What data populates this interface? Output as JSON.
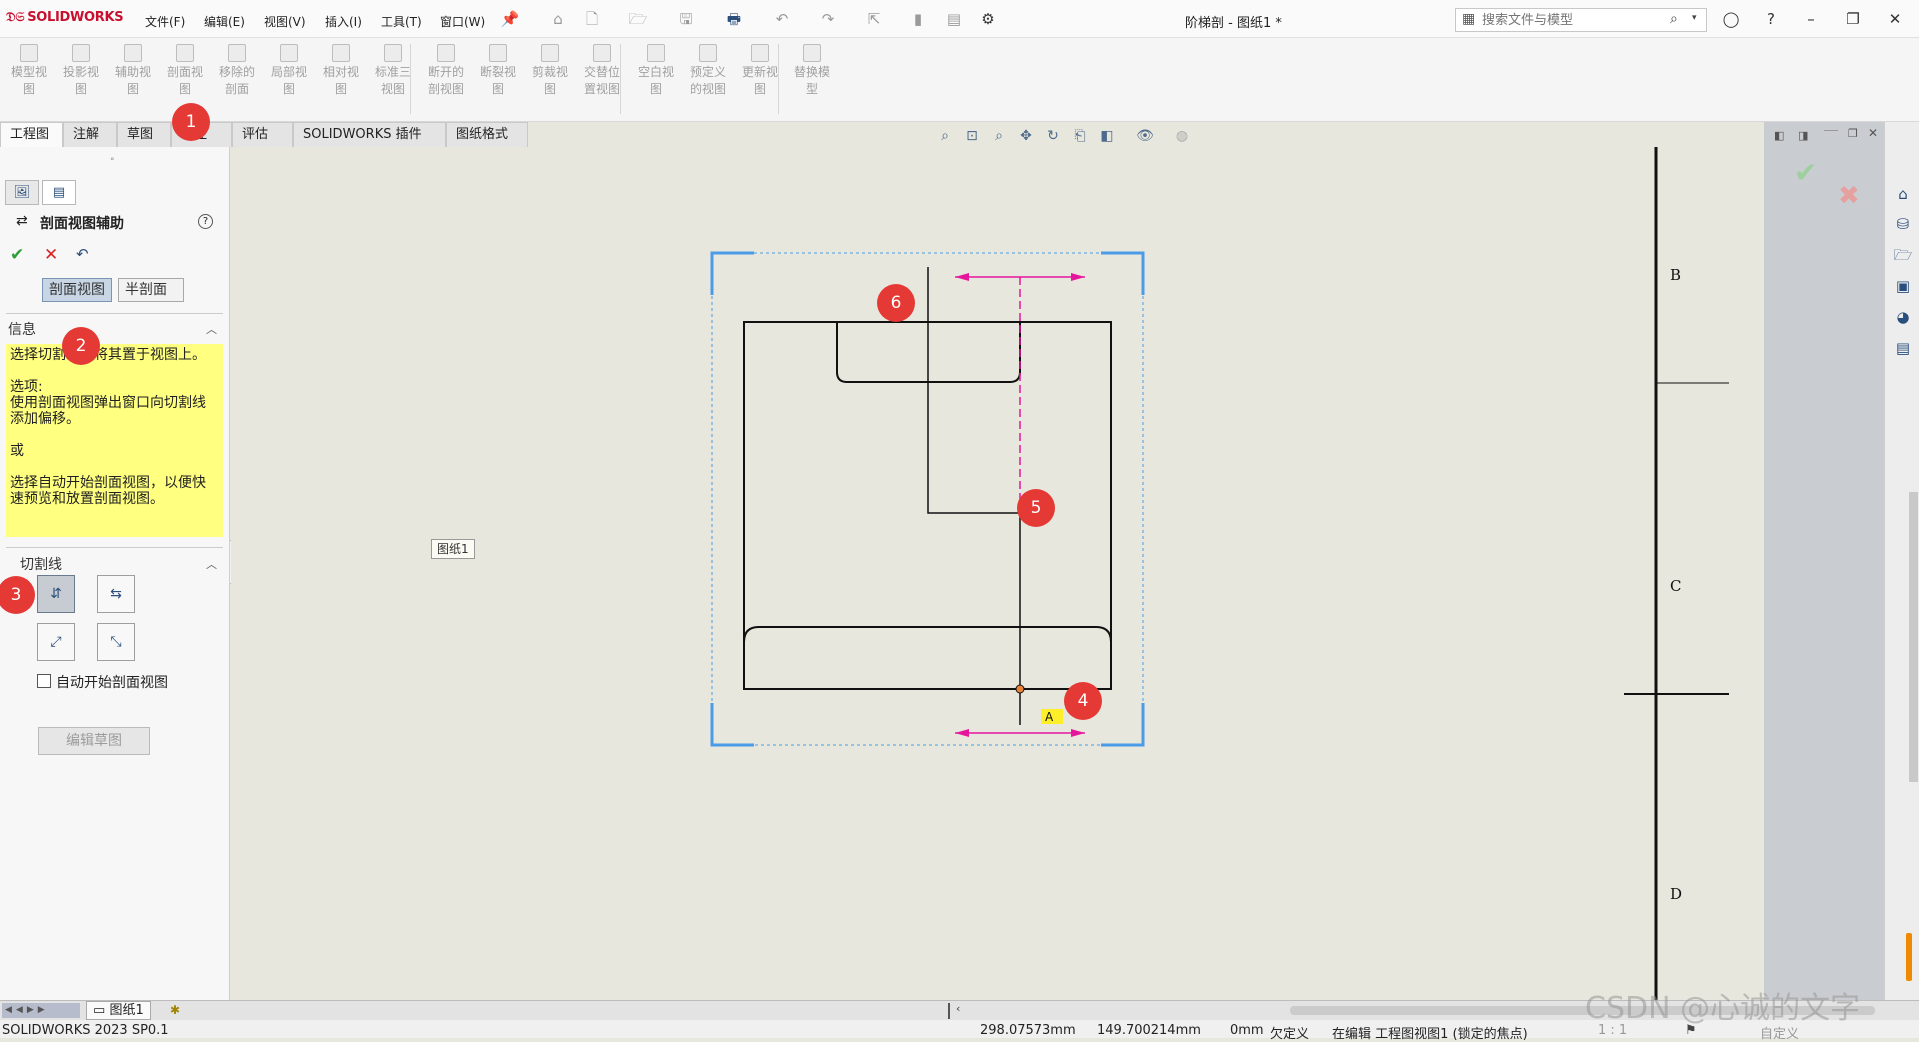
{
  "app": {
    "logo": "SOLIDWORKS",
    "doc_title": "阶梯剖 - 图纸1 *"
  },
  "menu": [
    "文件(F)",
    "编辑(E)",
    "视图(V)",
    "插入(I)",
    "工具(T)",
    "窗口(W)"
  ],
  "search": {
    "placeholder": "搜索文件与模型"
  },
  "commands": [
    [
      "模型视",
      "图"
    ],
    [
      "投影视",
      "图"
    ],
    [
      "辅助视",
      "图"
    ],
    [
      "剖面视",
      "图"
    ],
    [
      "移除的",
      "剖面"
    ],
    [
      "局部视",
      "图"
    ],
    [
      "相对视",
      "图"
    ],
    [
      "标准三",
      "视图"
    ],
    [
      "断开的",
      "剖视图"
    ],
    [
      "断裂视",
      "图"
    ],
    [
      "剪裁视",
      "图"
    ],
    [
      "交替位",
      "置视图"
    ],
    [
      "空白视",
      "图"
    ],
    [
      "预定义",
      "的视图"
    ],
    [
      "更新视",
      "图"
    ],
    [
      "替换模",
      "型"
    ]
  ],
  "tabs": [
    "工程图",
    "注解",
    "草图",
    "标注",
    "评估",
    "SOLIDWORKS 插件",
    "图纸格式"
  ],
  "property_manager": {
    "title": "剖面视图辅助",
    "segments": [
      "剖面视图",
      "半剖面"
    ],
    "info_title": "信息",
    "info_text": "选择切割线并将其置于视图上。\n\n选项:\n使用剖面视图弹出窗口向切割线添加偏移。\n\n或\n\n选择自动开始剖面视图，以便快速预览和放置剖面视图。",
    "cutline_title": "切割线",
    "auto_start_label": "自动开始剖面视图",
    "edit_sketch_label": "编辑草图"
  },
  "canvas": {
    "sheet_tooltip": "图纸1",
    "section_label": "A",
    "zone_labels": [
      "B",
      "C",
      "D"
    ]
  },
  "annotations": [
    "1",
    "2",
    "3",
    "4",
    "5",
    "6"
  ],
  "sheet_tab": "图纸1",
  "status": {
    "version": "SOLIDWORKS 2023 SP0.1",
    "x": "298.07573mm",
    "y": "149.700214mm",
    "z": "0mm",
    "definition": "欠定义",
    "editing": "在编辑 工程图视图1 (锁定的焦点)",
    "scale": "1 : 1",
    "units": "自定义"
  },
  "watermark": "CSDN @心诚的文字",
  "colors": {
    "accent_red": "#e53935",
    "info_bg": "#ffff80",
    "magenta": "#e6169c",
    "viewbox_blue": "#4a9be8",
    "confirm_green": "#2e9e3a",
    "cancel_red": "#d22"
  }
}
